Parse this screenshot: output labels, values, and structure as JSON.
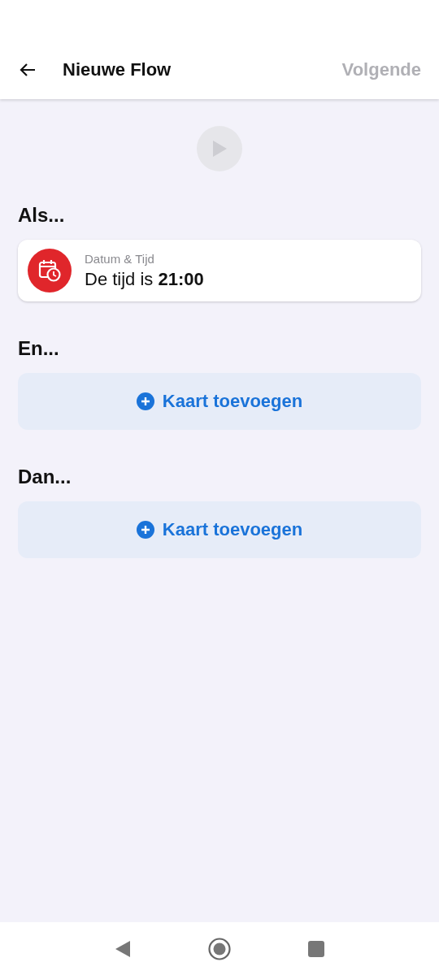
{
  "app_bar": {
    "title": "Nieuwe Flow",
    "next_button": {
      "label": "Volgende",
      "disabled": true
    }
  },
  "test_button": {
    "disabled": true
  },
  "sections": [
    {
      "heading": "Als...",
      "cards": [
        {
          "kind": "card",
          "category": "Datum & Tijd",
          "text": "De tijd is **21:00**",
          "color": "#e0262b"
        }
      ]
    },
    {
      "heading": "En...",
      "cards": [
        {
          "kind": "add",
          "label": "Kaart toevoegen"
        }
      ]
    },
    {
      "heading": "Dan...",
      "cards": [
        {
          "kind": "add",
          "label": "Kaart toevoegen"
        }
      ]
    }
  ]
}
